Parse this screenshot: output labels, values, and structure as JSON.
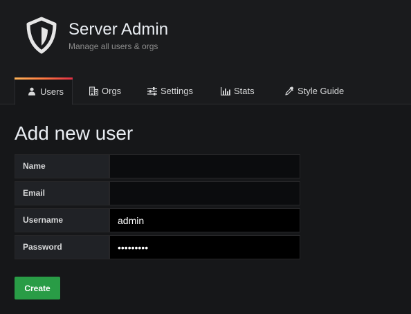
{
  "header": {
    "title": "Server Admin",
    "subtitle": "Manage all users & orgs",
    "logo_icon": "shield-icon"
  },
  "tabs": [
    {
      "label": "Users",
      "icon": "user-icon",
      "active": true
    },
    {
      "label": "Orgs",
      "icon": "building-icon",
      "active": false
    },
    {
      "label": "Settings",
      "icon": "sliders-icon",
      "active": false
    },
    {
      "label": "Stats",
      "icon": "bar-chart-icon",
      "active": false
    },
    {
      "label": "Style Guide",
      "icon": "eyedropper-icon",
      "active": false
    }
  ],
  "main": {
    "title": "Add new user"
  },
  "form": {
    "name": {
      "label": "Name",
      "value": ""
    },
    "email": {
      "label": "Email",
      "value": ""
    },
    "username": {
      "label": "Username",
      "value": "admin"
    },
    "password": {
      "label": "Password",
      "value": "•••••••••"
    }
  },
  "create_button": {
    "label": "Create"
  },
  "colors": {
    "accent_gradient": [
      "#ffb357",
      "#ff7941",
      "#e02f44"
    ],
    "primary_button": "#299c46",
    "background": "#161719"
  }
}
